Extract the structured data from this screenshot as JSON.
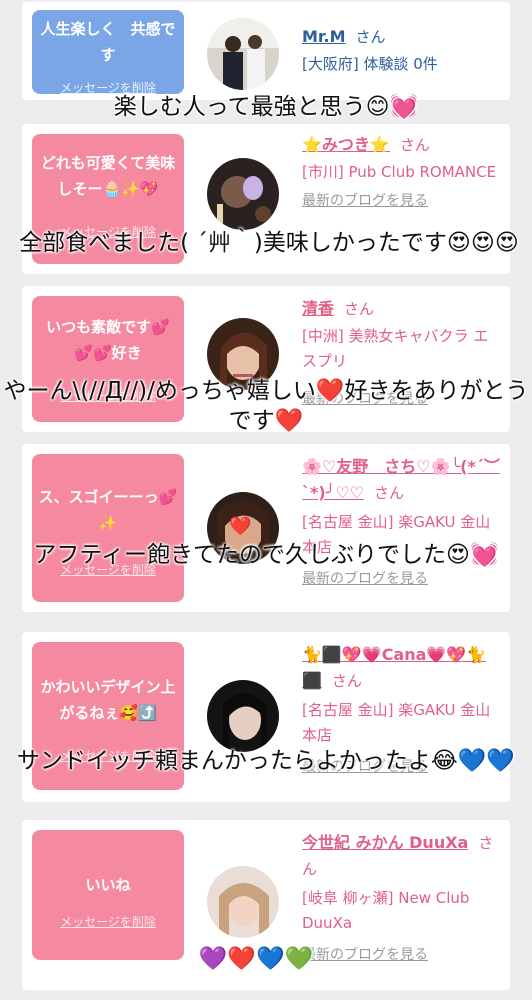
{
  "entries": [
    {
      "message": "人生楽しく　共感です",
      "delete_label": "メッセージを削除",
      "name": "Mr.M",
      "san": "さん",
      "shop": "[大阪府] 体験談 0件",
      "blog": "",
      "caption": "楽しむ人って最強と思う😊💓"
    },
    {
      "message": "どれも可愛くて美味しそー🧁✨💖",
      "delete_label": "メッセージを削除",
      "name": "⭐みつき⭐",
      "san": "さん",
      "shop": "[市川] Pub Club ROMANCE",
      "blog": "最新のブログを見る",
      "caption": "全部食べました( ´艸｀)美味しかったです😍😍😍"
    },
    {
      "message": "いつも素敵です💕💕💕好き",
      "delete_label": "メッセージを削除",
      "name": "清香",
      "san": "さん",
      "shop": "[中洲] 美熟女キャバクラ エスプリ",
      "blog": "最新のブログを見る",
      "caption": "やーん\\(//Д//)/めっちゃ嬉しい❤️好きをありがとうです❤️"
    },
    {
      "message": "ス、スゴイーーっ💕✨",
      "delete_label": "メッセージを削除",
      "name": "🌸♡友野　さち♡🌸╰(*´︶`*)╯♡♡",
      "san": "さん",
      "shop": "[名古屋 金山] 楽GAKU 金山本店",
      "blog": "最新のブログを見る",
      "caption": "アフティー飽きてたので久しぶりでした😍💓"
    },
    {
      "message": "かわいいデザイン上がるねぇ🥰⤴️",
      "delete_label": "メッセージを削除",
      "name": "🐈⬛💖💗Cana💗💖🐈⬛",
      "san": "さん",
      "shop": "[名古屋 金山] 楽GAKU 金山本店",
      "blog": "最新のブログを見る",
      "caption": "サンドイッチ頼まんかったらよかったよ😂💙💙"
    },
    {
      "message": "いいね",
      "delete_label": "メッセージを削除",
      "name": "今世紀 みかん DuuXa",
      "san": "さん",
      "shop": "[岐阜 柳ヶ瀬] New Club DuuXa",
      "blog": "最新のブログを見る",
      "caption": "💜❤️💙💚"
    }
  ],
  "colors": {
    "pink": "#f5899f",
    "blue": "#7aa6e6",
    "name_pink": "#e06086",
    "name_blue": "#2e5f9c"
  }
}
